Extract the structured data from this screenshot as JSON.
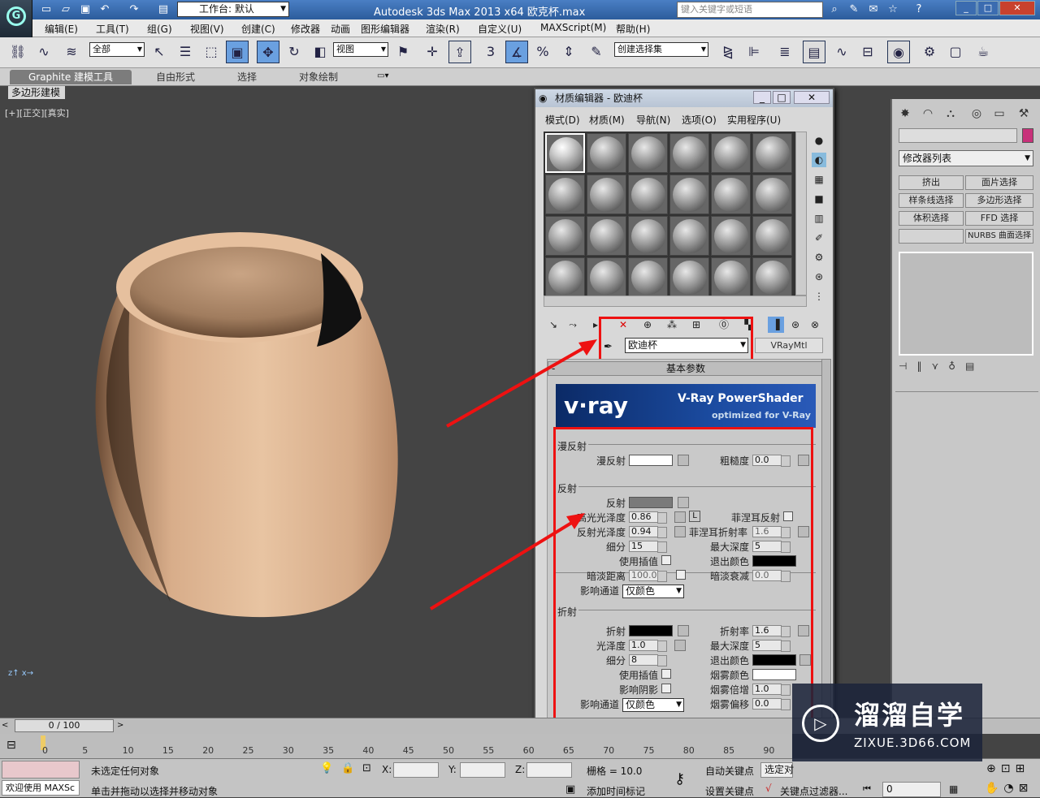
{
  "titlebar": {
    "workspace_label": "工作台: 默认",
    "app_title": "Autodesk 3ds Max  2013 x64     欧克杯.max",
    "search_placeholder": "键入关键字或短语",
    "window_controls": [
      "_",
      "□",
      "✕"
    ]
  },
  "menubar": [
    "编辑(E)",
    "工具(T)",
    "组(G)",
    "视图(V)",
    "创建(C)",
    "修改器",
    "动画",
    "图形编辑器",
    "渲染(R)",
    "自定义(U)",
    "MAXScript(M)",
    "帮助(H)"
  ],
  "toolbar": {
    "selection_filter": "全部",
    "ref_coord": "视图",
    "named_selection": "创建选择集"
  },
  "ribbon": {
    "tabs": [
      "Graphite 建模工具",
      "自由形式",
      "选择",
      "对象绘制"
    ],
    "sub_label": "多边形建模"
  },
  "viewport": {
    "label": "[+][正交][真实]"
  },
  "command_panel": {
    "modifier_list": "修改器列表",
    "buttons": [
      "挤出",
      "面片选择",
      "样条线选择",
      "多边形选择",
      "体积选择",
      "FFD 选择",
      "",
      "NURBS 曲面选择"
    ],
    "color_swatch": "#c8317a"
  },
  "material_editor": {
    "title": "材质编辑器 - 欧迪杯",
    "menus": [
      "模式(D)",
      "材质(M)",
      "导航(N)",
      "选项(O)",
      "实用程序(U)"
    ],
    "material_name": "欧迪杯",
    "material_type": "VRayMtl",
    "rollout_title": "基本参数",
    "banner_logo": "v·ray",
    "banner_title": "V-Ray PowerShader",
    "banner_sub": "optimized for V-Ray",
    "diffuse": {
      "group": "漫反射",
      "label": "漫反射",
      "color": "#ffffff",
      "roughness_label": "粗糙度",
      "roughness": "0.0"
    },
    "reflection": {
      "group": "反射",
      "reflect_label": "反射",
      "reflect_color": "#7a7a7a",
      "hilight_gloss_label": "高光光泽度",
      "hilight_gloss": "0.86",
      "l_label": "L",
      "fresnel_label": "菲涅耳反射",
      "refl_gloss_label": "反射光泽度",
      "refl_gloss": "0.94",
      "fresnel_ior_label": "菲涅耳折射率",
      "fresnel_ior": "1.6",
      "subdivs_label": "细分",
      "subdivs": "15",
      "max_depth_label": "最大深度",
      "max_depth": "5",
      "use_interp_label": "使用插值",
      "exit_color_label": "退出颜色",
      "exit_color": "#000000",
      "dim_dist_label": "暗淡距离",
      "dim_dist": "100.0",
      "dim_falloff_label": "暗淡衰减",
      "dim_falloff": "0.0",
      "affect_channels_label": "影响通道",
      "affect_channels": "仅颜色"
    },
    "refraction": {
      "group": "折射",
      "refract_label": "折射",
      "refract_color": "#000000",
      "ior_label": "折射率",
      "ior": "1.6",
      "gloss_label": "光泽度",
      "gloss": "1.0",
      "max_depth_label": "最大深度",
      "max_depth": "5",
      "subdivs_label": "细分",
      "subdivs": "8",
      "exit_color_label": "退出颜色",
      "exit_color": "#000000",
      "use_interp_label": "使用插值",
      "fog_color_label": "烟雾颜色",
      "fog_color": "#ffffff",
      "affect_shadows_label": "影响阴影",
      "fog_mult_label": "烟雾倍增",
      "fog_mult": "1.0",
      "affect_channels_label": "影响通道",
      "affect_channels": "仅颜色",
      "fog_bias_label": "烟雾偏移",
      "fog_bias": "0.0"
    }
  },
  "timeline": {
    "frame_counter": "0 / 100",
    "ticks": [
      "0",
      "5",
      "10",
      "15",
      "20",
      "25",
      "30",
      "35",
      "40",
      "45",
      "50",
      "55",
      "60",
      "65",
      "70",
      "75",
      "80",
      "85",
      "90"
    ]
  },
  "status": {
    "maxscript": "欢迎使用 MAXSc",
    "selection": "未选定任何对象",
    "prompt": "单击并拖动以选择并移动对象",
    "x_label": "X:",
    "y_label": "Y:",
    "z_label": "Z:",
    "grid": "栅格 = 10.0",
    "add_time_tag": "添加时间标记",
    "auto_key": "自动关键点",
    "auto_key_sel": "选定对",
    "set_key": "设置关键点",
    "key_filters": "关键点过滤器...",
    "frame": "0"
  },
  "watermark": {
    "title": "溜溜自学",
    "url": "ZIXUE.3D66.COM"
  }
}
